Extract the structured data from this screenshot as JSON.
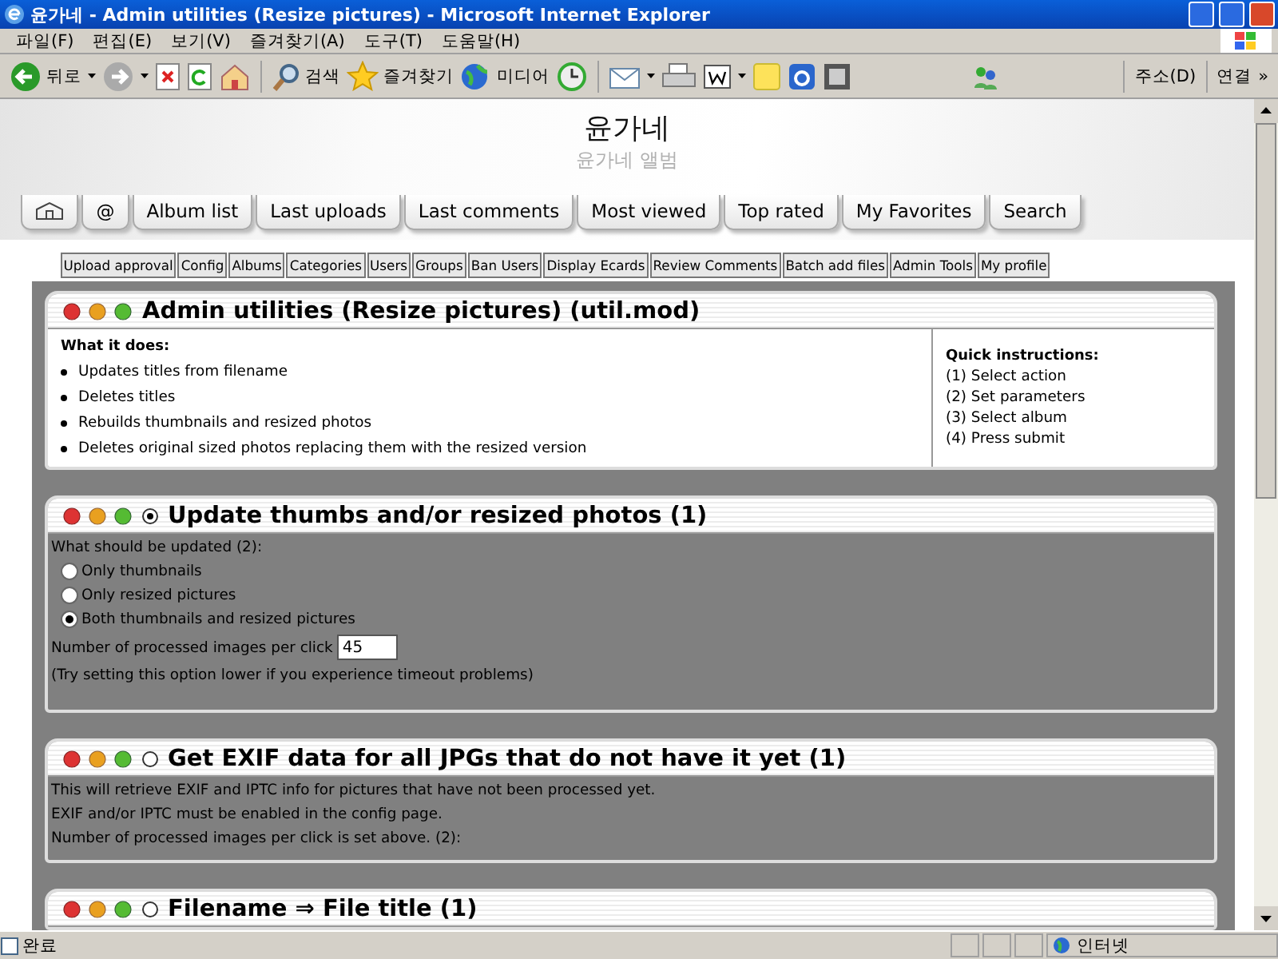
{
  "window": {
    "title": "윤가네 - Admin utilities (Resize pictures) - Microsoft Internet Explorer"
  },
  "menu_bar": [
    "파일(F)",
    "편집(E)",
    "보기(V)",
    "즐겨찾기(A)",
    "도구(T)",
    "도움말(H)"
  ],
  "toolbar": {
    "back_label": "뒤로",
    "search_label": "검색",
    "favorites_label": "즐겨찾기",
    "media_label": "미디어",
    "address_label": "주소(D)",
    "links_label": "연결",
    "more": "»"
  },
  "header": {
    "site_title": "윤가네",
    "site_subtitle": "윤가네 앨범"
  },
  "main_tabs": [
    {
      "kind": "icon"
    },
    {
      "kind": "text",
      "label": "@"
    },
    {
      "kind": "text",
      "label": "Album list"
    },
    {
      "kind": "text",
      "label": "Last uploads"
    },
    {
      "kind": "text",
      "label": "Last comments"
    },
    {
      "kind": "text",
      "label": "Most viewed"
    },
    {
      "kind": "text",
      "label": "Top rated"
    },
    {
      "kind": "text",
      "label": "My Favorites"
    },
    {
      "kind": "text",
      "label": "Search"
    }
  ],
  "admin_menu": [
    "Upload approval",
    "Config",
    "Albums",
    "Categories",
    "Users",
    "Groups",
    "Ban Users",
    "Display Ecards",
    "Review Comments",
    "Batch add files",
    "Admin Tools",
    "My profile"
  ],
  "panels": [
    {
      "kind": "info",
      "title": "Admin utilities (Resize pictures) (util.mod)",
      "what_heading": "What it does:",
      "bullets": [
        "Updates titles from filename",
        "Deletes titles",
        "Rebuilds thumbnails and resized photos",
        "Deletes original sized photos replacing them with the resized version"
      ],
      "quick_heading": "Quick instructions:",
      "steps": [
        "(1) Select action",
        "(2) Set parameters",
        "(3) Select album",
        "(4) Press submit"
      ]
    },
    {
      "kind": "options",
      "title": "Update thumbs and/or resized photos (1)",
      "selected": true,
      "prompt": "What should be updated (2):",
      "options": [
        {
          "label": "Only thumbnails",
          "selected": false
        },
        {
          "label": "Only resized pictures",
          "selected": false
        },
        {
          "label": "Both thumbnails and resized pictures",
          "selected": true
        }
      ],
      "field_label": "Number of processed images per click",
      "field_value": "45",
      "note": "(Try setting this option lower if you experience timeout problems)"
    },
    {
      "kind": "text",
      "title": "Get EXIF data for all JPGs that do not have it yet (1)",
      "selected": false,
      "lines": [
        "This will retrieve EXIF and IPTC info for pictures that have not been processed yet.",
        "EXIF and/or IPTC must be enabled in the config page.",
        "Number of processed images per click is set above. (2):"
      ]
    },
    {
      "kind": "text",
      "title": "Filename ⇒ File title (1)",
      "selected": false
    }
  ],
  "status_bar": {
    "text": "완료",
    "zone": "인터넷"
  }
}
